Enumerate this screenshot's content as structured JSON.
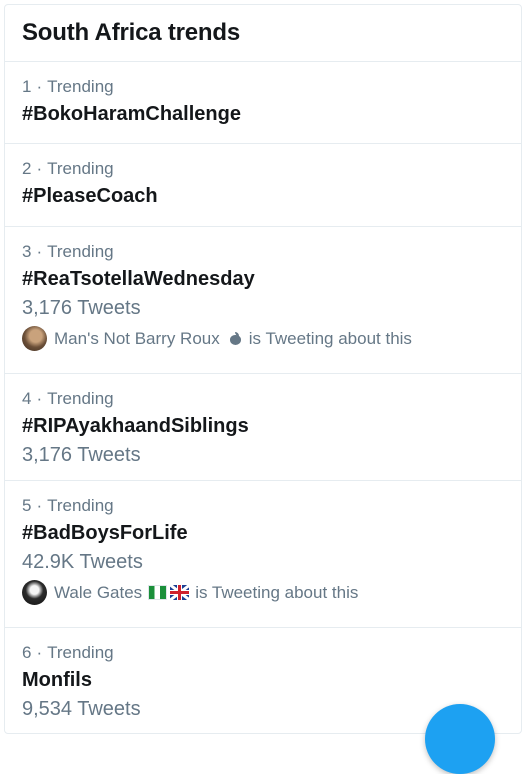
{
  "header": {
    "title": "South Africa trends"
  },
  "trends": [
    {
      "rank": "1",
      "label": "Trending",
      "name": "#BokoHaramChallenge"
    },
    {
      "rank": "2",
      "label": "Trending",
      "name": "#PleaseCoach"
    },
    {
      "rank": "3",
      "label": "Trending",
      "name": "#ReaTsotellaWednesday",
      "count": "3,176 Tweets",
      "context": {
        "user": "Man's Not Barry Roux",
        "suffix": "is Tweeting about this",
        "icon": "apple-icon"
      }
    },
    {
      "rank": "4",
      "label": "Trending",
      "name": "#RIPAyakhaandSiblings",
      "count": "3,176 Tweets"
    },
    {
      "rank": "5",
      "label": "Trending",
      "name": "#BadBoysForLife",
      "count": "42.9K Tweets",
      "context": {
        "user": "Wale Gates",
        "suffix": "is Tweeting about this",
        "icons": [
          "nigeria-flag-icon",
          "uk-flag-icon"
        ]
      }
    },
    {
      "rank": "6",
      "label": "Trending",
      "name": "Monfils",
      "count": "9,534 Tweets"
    }
  ],
  "colors": {
    "accent": "#1da1f2",
    "muted": "#657786",
    "text": "#14171a",
    "divider": "#e6ecf0"
  }
}
